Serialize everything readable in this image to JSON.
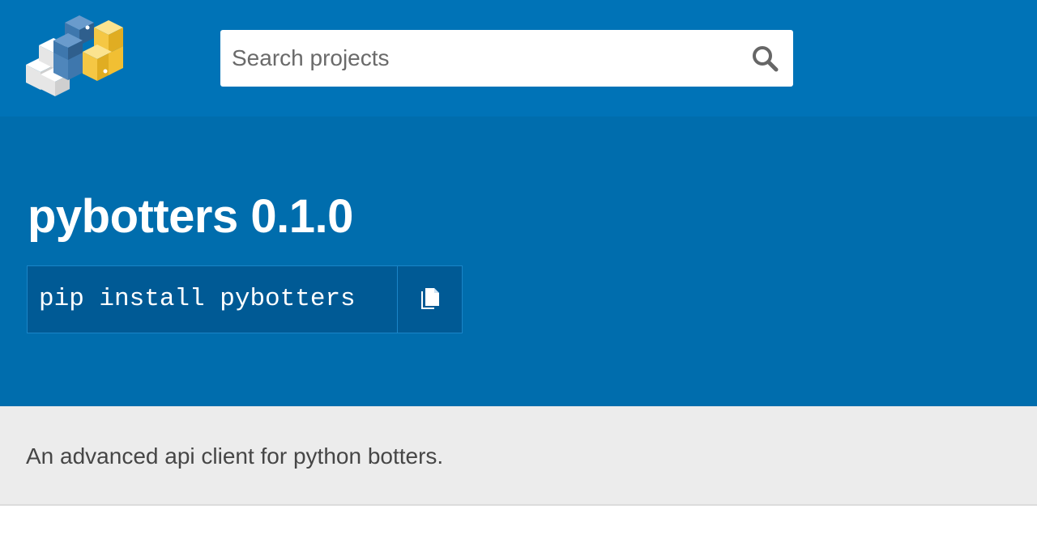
{
  "header": {
    "search": {
      "placeholder": "Search projects",
      "value": ""
    }
  },
  "package": {
    "title": "pybotters 0.1.0",
    "install_command": "pip install pybotters"
  },
  "summary": "An advanced api client for python botters.",
  "colors": {
    "header_bg": "#0073b7",
    "hero_bg": "#006dad",
    "pip_bg": "#005a95",
    "summary_bg": "#ececec",
    "logo_blue": "#3e77ad",
    "logo_yellow": "#f5c744"
  },
  "icons": {
    "search": "search-icon",
    "copy": "copy-icon",
    "logo": "pypi-logo"
  }
}
